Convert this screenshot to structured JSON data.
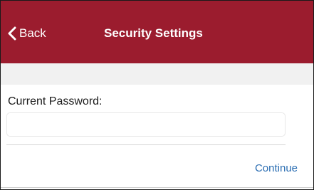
{
  "nav": {
    "back_label": "Back",
    "back_icon": "chevron-left-icon",
    "title": "Security Settings",
    "background_color": "#9b1c2e"
  },
  "form": {
    "current_password_label": "Current Password:",
    "current_password_value": "",
    "continue_label": "Continue",
    "link_color": "#2a6db2"
  }
}
